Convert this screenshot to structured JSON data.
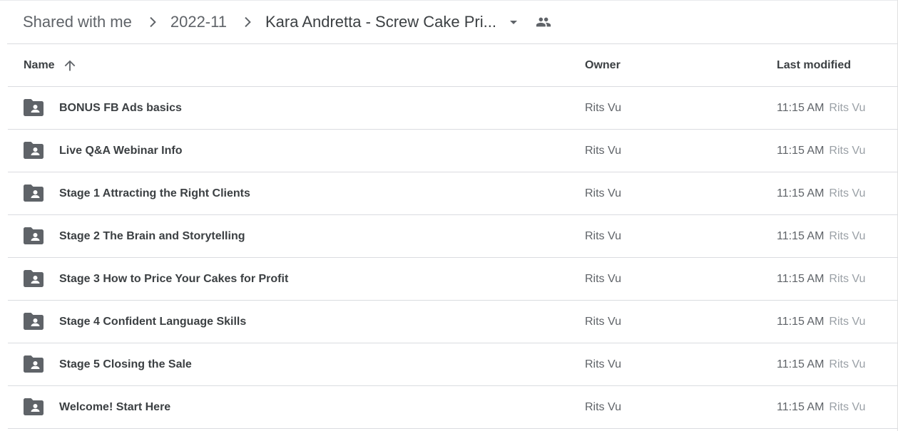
{
  "breadcrumb": {
    "items": [
      "Shared with me",
      "2022-11",
      "Kara Andretta - Screw Cake Pri..."
    ],
    "dropdown_icon": "arrow-drop-down-icon",
    "people_icon": "people-icon"
  },
  "table": {
    "columns": {
      "name": "Name",
      "owner": "Owner",
      "last_modified": "Last modified"
    },
    "sort": {
      "column": "Name",
      "direction": "ascending",
      "icon": "arrow-upward-icon"
    },
    "rows": [
      {
        "name": "BONUS FB Ads basics",
        "owner": "Rits Vu",
        "modified_time": "11:15 AM",
        "modified_by": "Rits Vu",
        "icon": "shared-folder-icon"
      },
      {
        "name": "Live Q&A Webinar Info",
        "owner": "Rits Vu",
        "modified_time": "11:15 AM",
        "modified_by": "Rits Vu",
        "icon": "shared-folder-icon"
      },
      {
        "name": "Stage 1 Attracting the Right Clients",
        "owner": "Rits Vu",
        "modified_time": "11:15 AM",
        "modified_by": "Rits Vu",
        "icon": "shared-folder-icon"
      },
      {
        "name": "Stage 2 The Brain and Storytelling",
        "owner": "Rits Vu",
        "modified_time": "11:15 AM",
        "modified_by": "Rits Vu",
        "icon": "shared-folder-icon"
      },
      {
        "name": "Stage 3 How to Price Your Cakes for Profit",
        "owner": "Rits Vu",
        "modified_time": "11:15 AM",
        "modified_by": "Rits Vu",
        "icon": "shared-folder-icon"
      },
      {
        "name": "Stage 4 Confident Language Skills",
        "owner": "Rits Vu",
        "modified_time": "11:15 AM",
        "modified_by": "Rits Vu",
        "icon": "shared-folder-icon"
      },
      {
        "name": "Stage 5 Closing the Sale",
        "owner": "Rits Vu",
        "modified_time": "11:15 AM",
        "modified_by": "Rits Vu",
        "icon": "shared-folder-icon"
      },
      {
        "name": "Welcome! Start Here",
        "owner": "Rits Vu",
        "modified_time": "11:15 AM",
        "modified_by": "Rits Vu",
        "icon": "shared-folder-icon"
      }
    ]
  },
  "colors": {
    "text_primary": "#3c4043",
    "text_secondary": "#5f6368",
    "text_muted": "#9aa0a6",
    "divider": "#dadce0",
    "icon": "#5f6368"
  }
}
